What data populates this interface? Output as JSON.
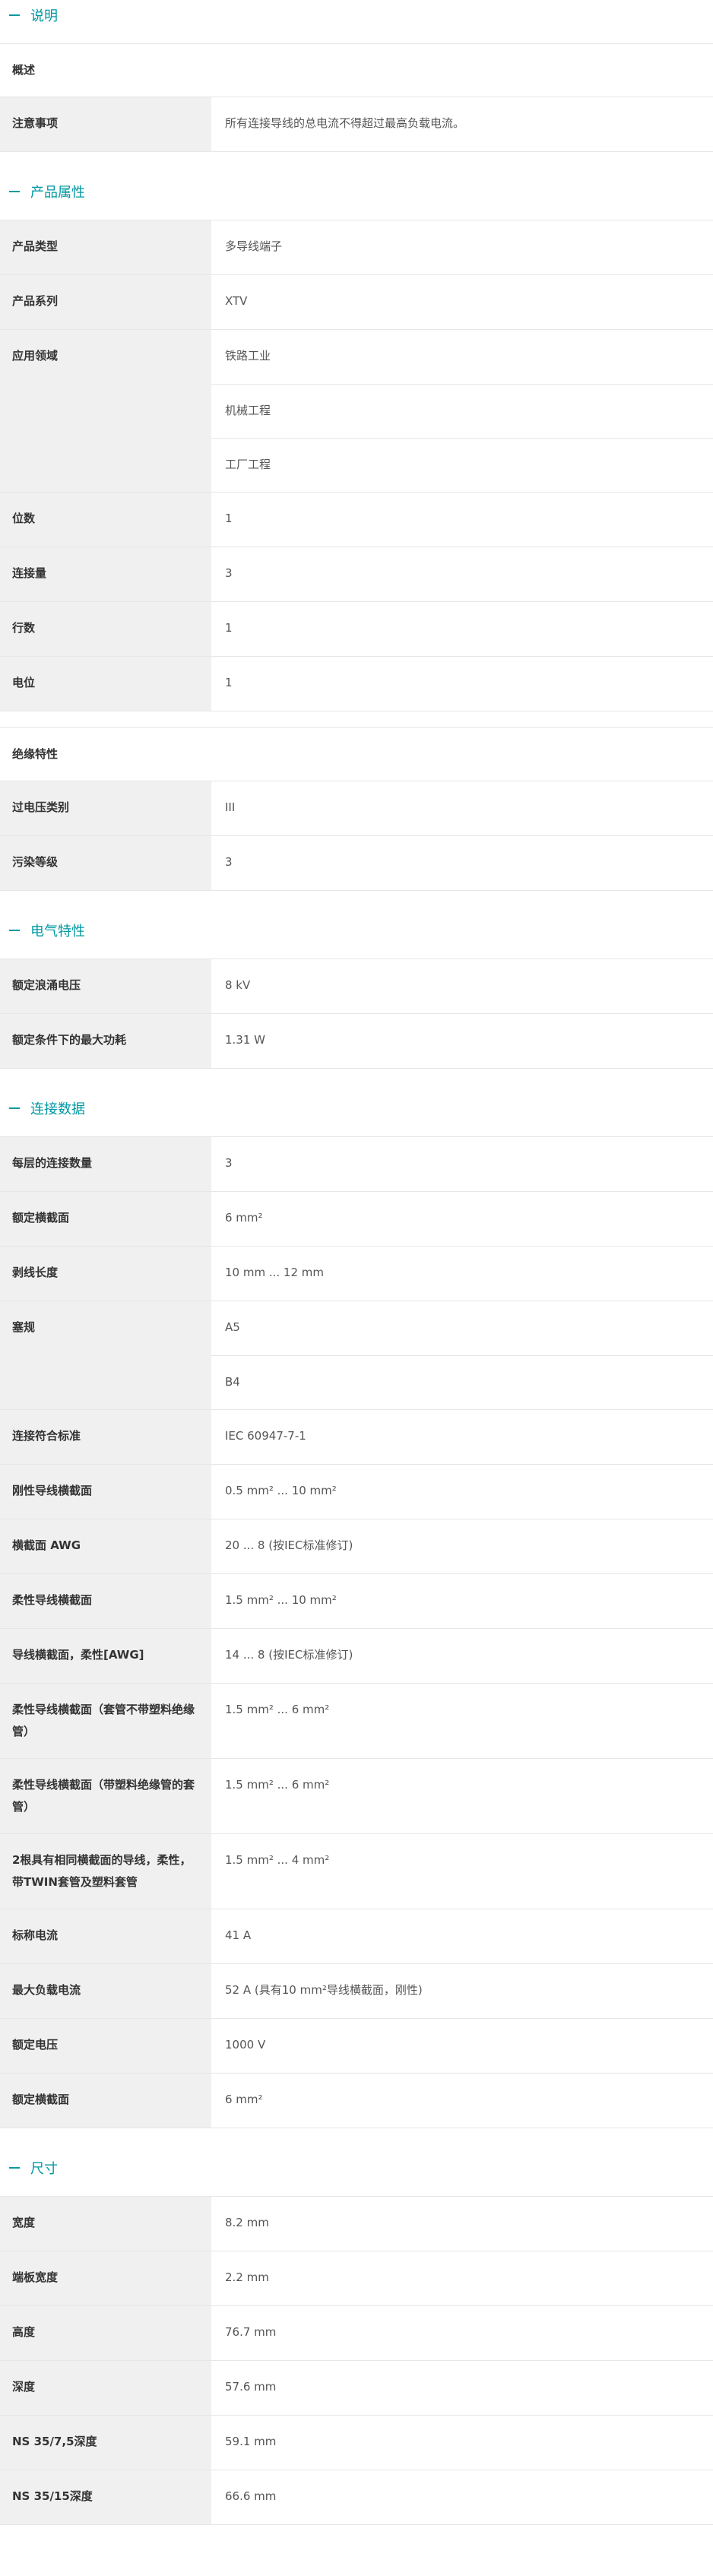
{
  "sections": [
    {
      "title": "说明",
      "rows": [
        {
          "type": "heading",
          "label": "概述"
        },
        {
          "label": "注意事项",
          "values": [
            "所有连接导线的总电流不得超过最高负载电流。"
          ]
        }
      ]
    },
    {
      "title": "产品属性",
      "rows": [
        {
          "label": "产品类型",
          "values": [
            "多导线端子"
          ]
        },
        {
          "label": "产品系列",
          "values": [
            "XTV"
          ]
        },
        {
          "label": "应用领域",
          "values": [
            "铁路工业",
            "机械工程",
            "工厂工程"
          ]
        },
        {
          "label": "位数",
          "values": [
            "1"
          ]
        },
        {
          "label": "连接量",
          "values": [
            "3"
          ]
        },
        {
          "label": "行数",
          "values": [
            "1"
          ]
        },
        {
          "label": "电位",
          "values": [
            "1"
          ]
        },
        {
          "type": "subheading",
          "label": "绝缘特性"
        },
        {
          "label": "过电压类别",
          "values": [
            "III"
          ]
        },
        {
          "label": "污染等级",
          "values": [
            "3"
          ]
        }
      ]
    },
    {
      "title": "电气特性",
      "rows": [
        {
          "label": "额定浪涌电压",
          "values": [
            "8 kV"
          ]
        },
        {
          "label": "额定条件下的最大功耗",
          "values": [
            "1.31 W"
          ]
        }
      ]
    },
    {
      "title": "连接数据",
      "rows": [
        {
          "label": "每层的连接数量",
          "values": [
            "3"
          ]
        },
        {
          "label": "额定横截面",
          "values": [
            "6 mm²"
          ]
        },
        {
          "label": "剥线长度",
          "values": [
            "10 mm ... 12 mm"
          ]
        },
        {
          "label": "塞规",
          "values": [
            "A5",
            "B4"
          ]
        },
        {
          "label": "连接符合标准",
          "values": [
            "IEC 60947-7-1"
          ]
        },
        {
          "label": "刚性导线横截面",
          "values": [
            "0.5 mm² ... 10 mm²"
          ]
        },
        {
          "label": "横截面 AWG",
          "values": [
            "20 ... 8 (按IEC标准修订)"
          ]
        },
        {
          "label": "柔性导线横截面",
          "values": [
            "1.5 mm² ... 10 mm²"
          ]
        },
        {
          "label": "导线横截面，柔性[AWG]",
          "values": [
            "14 ... 8 (按IEC标准修订)"
          ]
        },
        {
          "label": "柔性导线横截面（套管不带塑料绝缘管）",
          "values": [
            "1.5 mm² ... 6 mm²"
          ]
        },
        {
          "label": "柔性导线横截面（带塑料绝缘管的套管）",
          "values": [
            "1.5 mm² ... 6 mm²"
          ]
        },
        {
          "label": "2根具有相同横截面的导线，柔性，带TWIN套管及塑料套管",
          "values": [
            "1.5 mm² ... 4 mm²"
          ]
        },
        {
          "label": "标称电流",
          "values": [
            "41 A"
          ]
        },
        {
          "label": "最大负载电流",
          "values": [
            "52 A (具有10 mm²导线横截面，刚性)"
          ]
        },
        {
          "label": "额定电压",
          "values": [
            "1000 V"
          ]
        },
        {
          "label": "额定横截面",
          "values": [
            "6 mm²"
          ]
        }
      ]
    },
    {
      "title": "尺寸",
      "rows": [
        {
          "label": "宽度",
          "values": [
            "8.2 mm"
          ]
        },
        {
          "label": "端板宽度",
          "values": [
            "2.2 mm"
          ]
        },
        {
          "label": "高度",
          "values": [
            "76.7 mm"
          ]
        },
        {
          "label": "深度",
          "values": [
            "57.6 mm"
          ]
        },
        {
          "label": "NS 35/7,5深度",
          "values": [
            "59.1 mm"
          ]
        },
        {
          "label": "NS 35/15深度",
          "values": [
            "66.6 mm"
          ]
        }
      ]
    }
  ]
}
